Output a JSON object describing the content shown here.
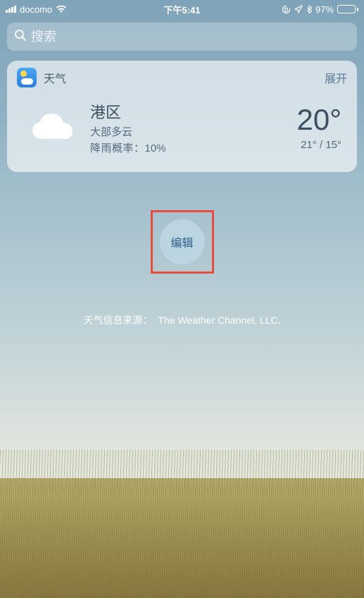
{
  "status_bar": {
    "carrier": "docomo",
    "time": "下午5:41",
    "battery_percent_text": "97%",
    "battery_fill_percent": 97
  },
  "search": {
    "placeholder": "搜索"
  },
  "weather_widget": {
    "title": "天气",
    "expand_label": "展开",
    "location": "港区",
    "condition": "大部多云",
    "precip_label": "降雨概率：",
    "precip_value": "10%",
    "temp_current": "20°",
    "temp_high": "21°",
    "temp_low": "15°",
    "temp_range_sep": " / "
  },
  "edit_button_label": "编辑",
  "attribution": {
    "prefix": "天气信息来源：",
    "source": "The Weather Channel, LLC."
  }
}
